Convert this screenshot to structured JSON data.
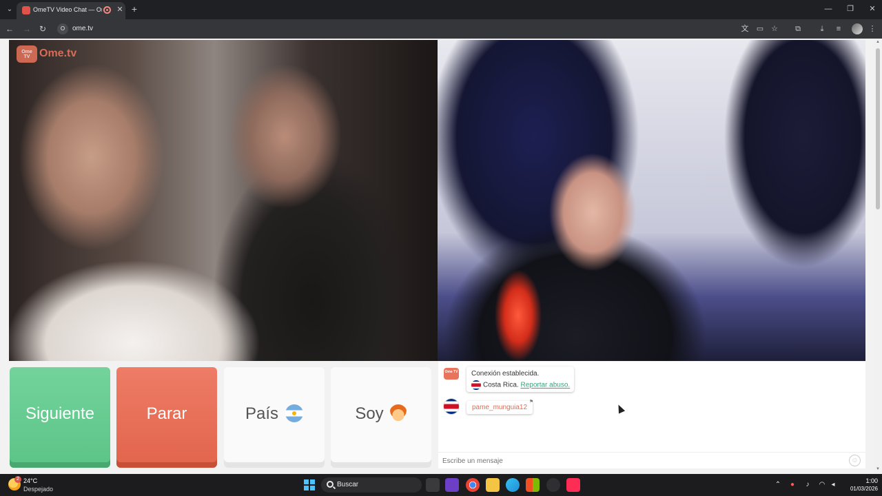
{
  "browser": {
    "tab_title": "OmeTV Video Chat — Omegle",
    "url": "ome.tv",
    "site_icon": "O"
  },
  "page": {
    "logo_badge": "Ome TV",
    "logo_text": "Ome.tv",
    "buttons": {
      "next": "Siguiente",
      "stop": "Parar",
      "country": "País",
      "gender": "Soy"
    },
    "chat": {
      "system_logo": "Ome TV",
      "connection_msg": "Conexión establecida.",
      "partner_country": "Costa Rica.",
      "report_link": "Reportar abuso.",
      "username": "pame_munguia12",
      "input_placeholder": "Escribe un mensaje"
    }
  },
  "taskbar": {
    "temperature": "24°C",
    "weather": "Despejado",
    "weather_badge": "2",
    "search_placeholder": "Buscar",
    "time": "1:00",
    "date": "01/03/2026"
  },
  "colors": {
    "next_button": "#5cc487",
    "stop_button": "#e2644c",
    "brand": "#e8745b",
    "link": "#3aa37a"
  },
  "icons": [
    "tab-list-icon",
    "recording-icon",
    "close-icon",
    "plus-icon",
    "minimize-icon",
    "restore-icon",
    "back-icon",
    "forward-icon",
    "reload-icon",
    "translate-icon",
    "cast-icon",
    "star-icon",
    "extensions-icon",
    "download-icon",
    "reading-list-icon",
    "profile-icon",
    "menu-icon",
    "argentina-flag-icon",
    "boy-icon",
    "costa-rica-flag-icon",
    "emoji-icon",
    "windows-start-icon",
    "search-icon"
  ]
}
